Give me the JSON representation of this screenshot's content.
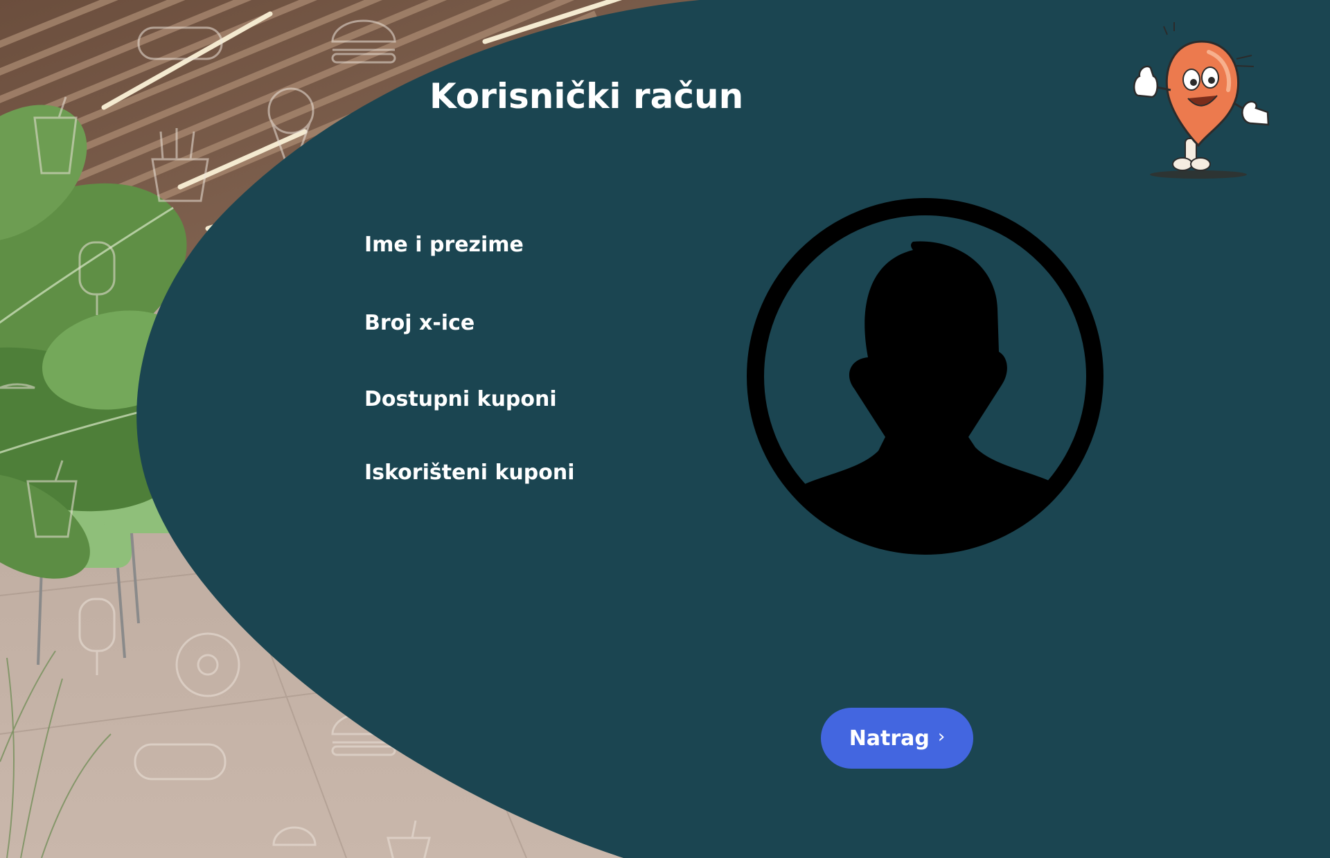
{
  "page": {
    "title": "Korisnički račun"
  },
  "account_fields": [
    {
      "label": "Ime i prezime"
    },
    {
      "label": "Broj x-ice"
    },
    {
      "label": "Dostupni kuponi"
    },
    {
      "label": "Iskorišteni kuponi"
    }
  ],
  "avatar": {
    "icon": "user-silhouette-icon"
  },
  "mascot": {
    "icon": "chicken-drumstick-mascot"
  },
  "actions": {
    "back_label": "Natrag",
    "back_icon": "chevron-right-icon"
  },
  "colors": {
    "panel": "#1b4551",
    "button": "#4366e0",
    "text": "#ffffff"
  }
}
